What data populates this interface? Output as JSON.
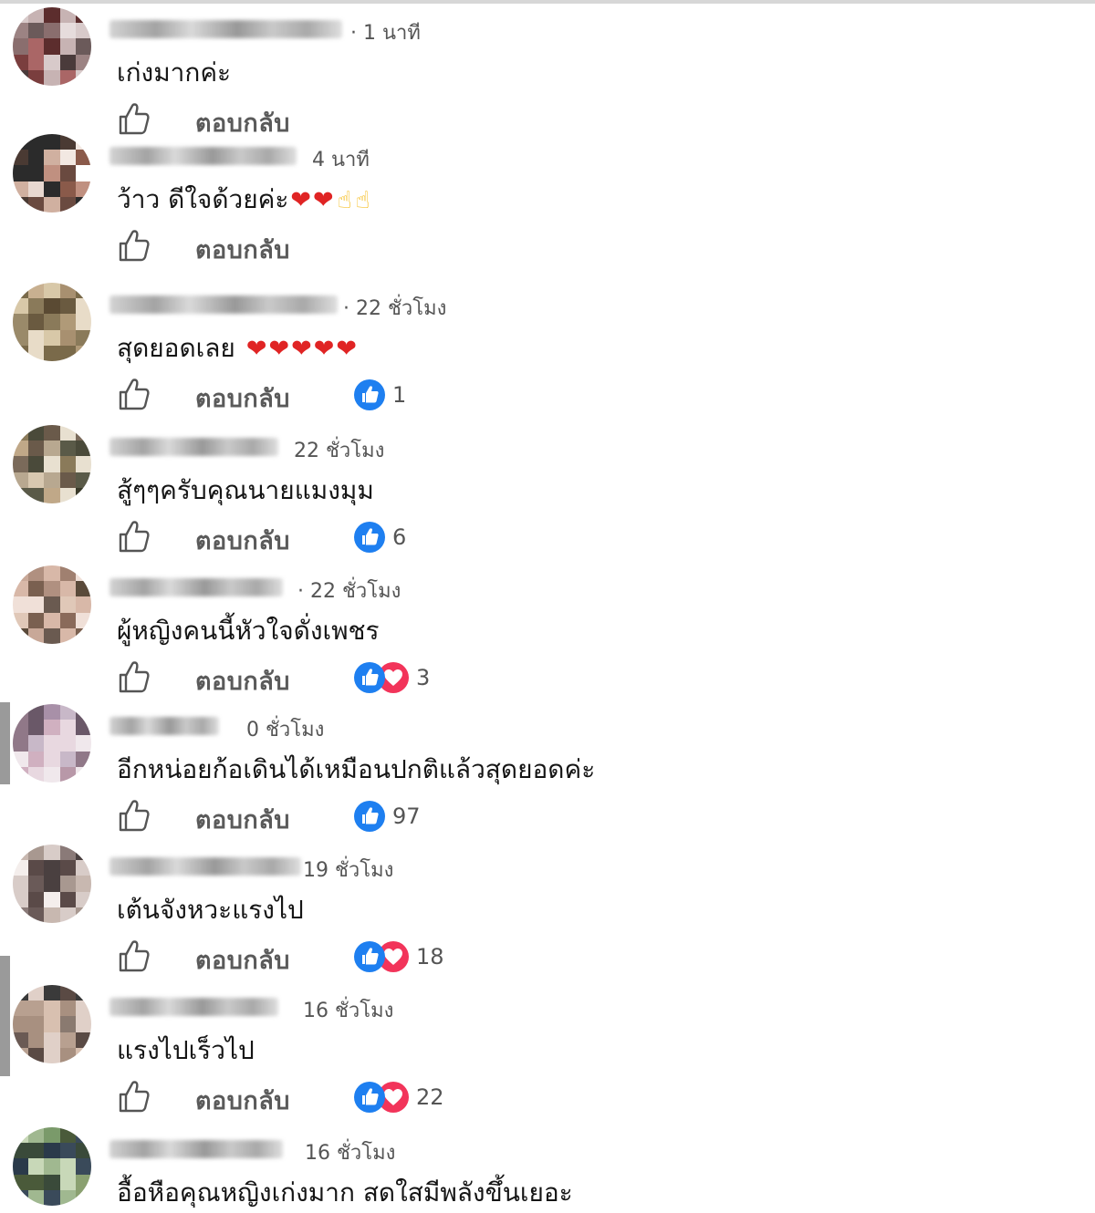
{
  "comments": [
    {
      "time": "· 1 นาที",
      "text": "เก่งมากค่ะ",
      "emoji": [],
      "reactions": null
    },
    {
      "time": "4 นาที",
      "text": "ว้าว ดีใจด้วยค่ะ",
      "emoji": [
        "heart",
        "heart",
        "thumbs-up",
        "thumbs-up"
      ],
      "reactions": null
    },
    {
      "time": "· 22 ชั่วโมง",
      "text": "สุดยอดเลย",
      "emoji": [
        "heart",
        "heart",
        "heart",
        "heart",
        "heart"
      ],
      "reactions": {
        "types": [
          "like"
        ],
        "count": "1"
      }
    },
    {
      "time": "22 ชั่วโมง",
      "text": "สู้ๆๆครับคุณนายแมงมุม",
      "emoji": [],
      "reactions": {
        "types": [
          "like"
        ],
        "count": "6"
      }
    },
    {
      "time": "· 22 ชั่วโมง",
      "text": "ผู้หญิงคนนี้หัวใจดั่งเพชร",
      "emoji": [],
      "reactions": {
        "types": [
          "like",
          "love"
        ],
        "count": "3"
      }
    },
    {
      "time": "0 ชั่วโมง",
      "text": "อีกหน่อยก้อเดินได้เหมือนปกติแล้วสุดยอดค่ะ",
      "emoji": [],
      "reactions": {
        "types": [
          "like"
        ],
        "count": "97"
      }
    },
    {
      "time": "19 ชั่วโมง",
      "text": "เต้นจังหวะแรงไป",
      "emoji": [],
      "reactions": {
        "types": [
          "like",
          "love"
        ],
        "count": "18"
      }
    },
    {
      "time": "16 ชั่วโมง",
      "text": "แรงไปเร็วไป",
      "emoji": [],
      "reactions": {
        "types": [
          "like",
          "love"
        ],
        "count": "22"
      }
    },
    {
      "time": "16 ชั่วโมง",
      "text": "อื้อหือคุณหญิงเก่งมาก สดใสมีพลังขึ้นเยอะ",
      "emoji": [],
      "reactions": null
    }
  ],
  "reply_label": "ตอบกลับ",
  "icons": {
    "like_outline": "thumbs-up-outline-icon",
    "like_reaction": "like-reaction-icon",
    "love_reaction": "love-reaction-icon",
    "heart": "red-heart-emoji",
    "thumbs": "thumbs-up-emoji"
  },
  "colors": {
    "like_blue": "#1e7ff0",
    "love_red": "#f2345a",
    "reply_gray": "#5a5a5a",
    "time_gray": "#555555"
  }
}
